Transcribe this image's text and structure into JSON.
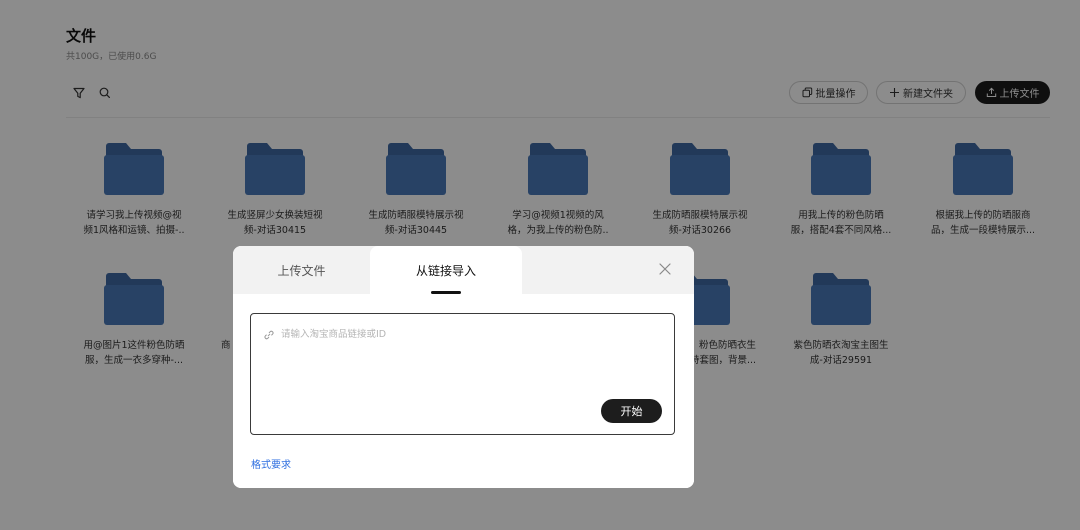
{
  "header": {
    "title": "文件",
    "subtitle": "共100G，已使用0.6G"
  },
  "toolbar": {
    "filter_icon": "filter-icon",
    "search_icon": "search-icon",
    "batch_label": "批量操作",
    "new_folder_label": "新建文件夹",
    "upload_label": "上传文件"
  },
  "folders": [
    {
      "name": "请学习我上传视频@视\n频1风格和运镜、拍摄-.."
    },
    {
      "name": "生成竖屏少女换装短视\n频-对话30415"
    },
    {
      "name": "生成防晒服模特展示视\n频-对话30445"
    },
    {
      "name": "学习@视频1视频的风\n格，为我上传的粉色防.."
    },
    {
      "name": "生成防晒服模特展示视\n频-对话30266"
    },
    {
      "name": "用我上传的粉色防晒\n服，搭配4套不同风格..."
    },
    {
      "name": "根据我上传的防晒服商\n品，生成一段模特展示..."
    },
    {
      "name": "用@图片1这件粉色防晒\n服，生成一衣多穿种-..."
    },
    {
      "name": "商"
    },
    {
      "name": "粉色防晒衣生\n特套图，背景..."
    },
    {
      "name": "紫色防晒衣淘宝主图生\n成-对话29591"
    }
  ],
  "modal": {
    "tabs": [
      {
        "label": "上传文件"
      },
      {
        "label": "从链接导入"
      }
    ],
    "input_placeholder": "请输入淘宝商品链接或ID",
    "start_label": "开始",
    "format_link": "格式要求"
  },
  "colors": {
    "folder_blue": "#4a79b8",
    "folder_tab": "#3e68a3",
    "primary_dark": "#1d1d1d",
    "link_blue": "#2f6fe0"
  }
}
